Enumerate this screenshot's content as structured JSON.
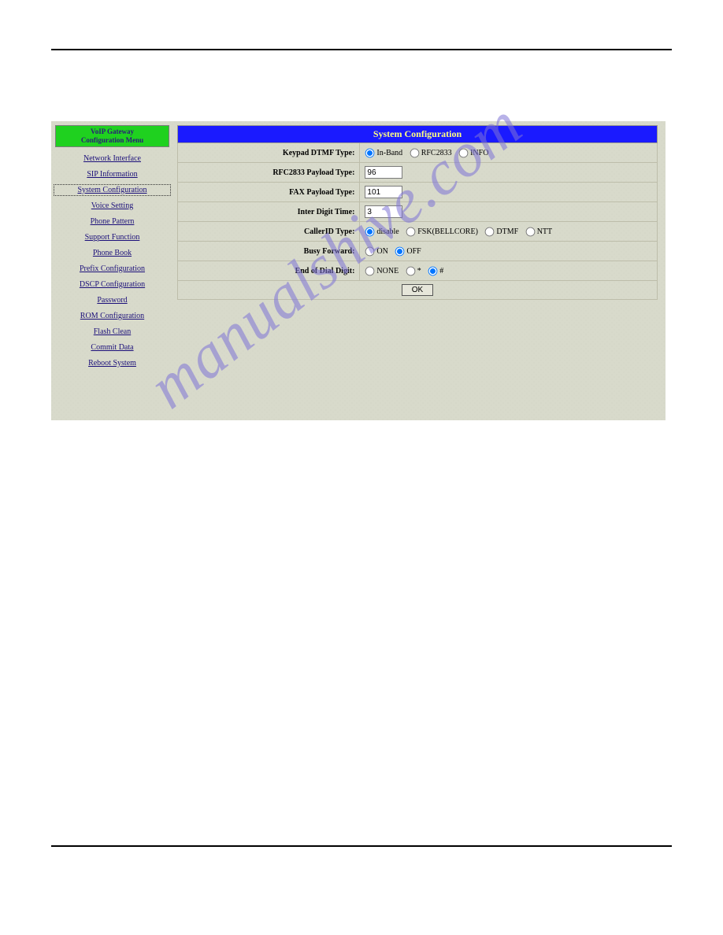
{
  "watermark": "manualshive.com",
  "sidebar": {
    "title_line1": "VoIP Gateway",
    "title_line2": "Configuration Menu",
    "items": [
      {
        "label": "Network Interface"
      },
      {
        "label": "SIP Information"
      },
      {
        "label": "System Configuration"
      },
      {
        "label": "Voice Setting"
      },
      {
        "label": "Phone Pattern"
      },
      {
        "label": "Support Function"
      },
      {
        "label": "Phone Book"
      },
      {
        "label": "Prefix Configuration"
      },
      {
        "label": "DSCP Configuration"
      },
      {
        "label": "Password"
      },
      {
        "label": "ROM Configuration"
      },
      {
        "label": "Flash Clean"
      },
      {
        "label": "Commit Data"
      },
      {
        "label": "Reboot System"
      }
    ],
    "active_index": 2
  },
  "config": {
    "title": "System Configuration",
    "rows": {
      "keypad_dtmf": {
        "label": "Keypad DTMF Type:",
        "options": [
          "In-Band",
          "RFC2833",
          "INFO"
        ],
        "selected": "In-Band"
      },
      "rfc2833_payload": {
        "label": "RFC2833 Payload Type:",
        "value": "96"
      },
      "fax_payload": {
        "label": "FAX Payload Type:",
        "value": "101"
      },
      "inter_digit": {
        "label": "Inter Digit Time:",
        "value": "3"
      },
      "caller_id": {
        "label": "CallerID Type:",
        "options": [
          "disable",
          "FSK(BELLCORE)",
          "DTMF",
          "NTT"
        ],
        "selected": "disable"
      },
      "busy_forward": {
        "label": "Busy Forward:",
        "options": [
          "ON",
          "OFF"
        ],
        "selected": "OFF"
      },
      "end_of_dial": {
        "label": "End of Dial Digit:",
        "options": [
          "NONE",
          "*",
          "#"
        ],
        "selected": "#"
      }
    },
    "ok_label": "OK"
  }
}
